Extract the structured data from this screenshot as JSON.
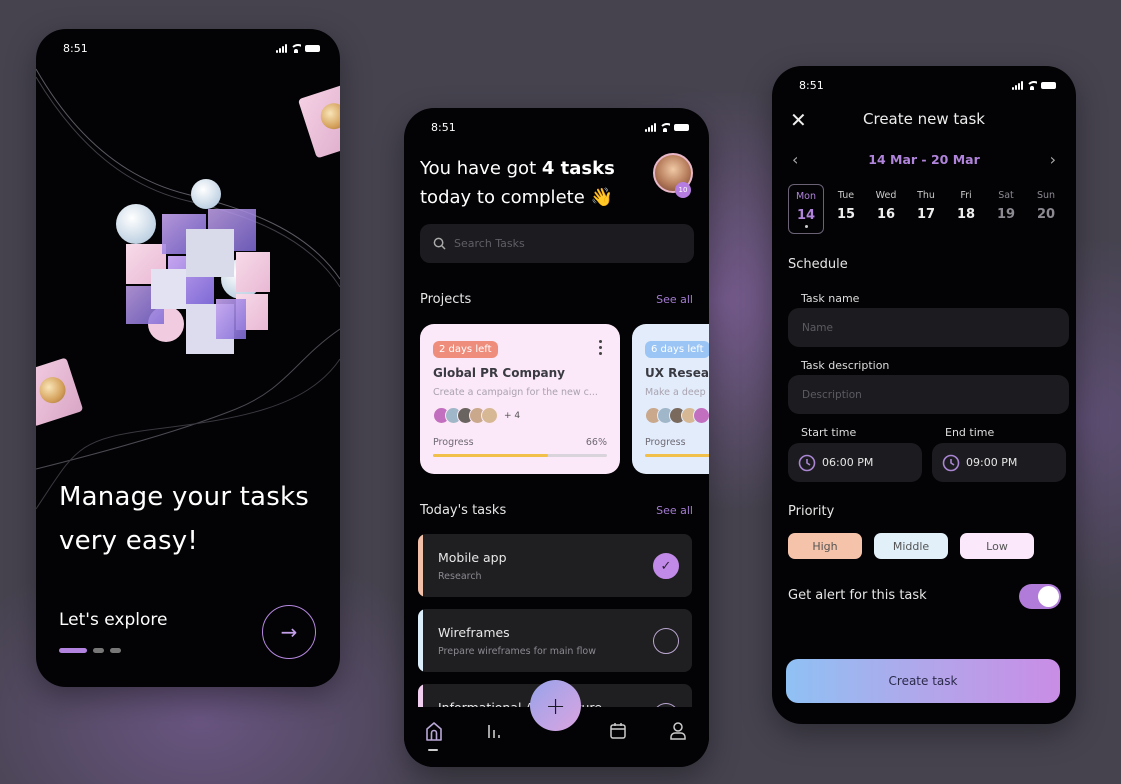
{
  "status": {
    "time": "8:51"
  },
  "onboarding": {
    "title": "Manage your tasks very easy!",
    "explore_label": "Let's explore",
    "page_count": 3,
    "active_page": 1,
    "accent": "#b383e0"
  },
  "home": {
    "greeting_prefix": "You have got",
    "greeting_count": "4 tasks",
    "greeting_suffix": "today to complete",
    "greeting_emoji": "👋",
    "avatar_badge": "10",
    "search_placeholder": "Search Tasks",
    "projects_title": "Projects",
    "see_all": "See all",
    "projects": [
      {
        "badge": "2 days left",
        "badge_color": "#ef8d7d",
        "bg": "#fbe8f8",
        "title": "Global PR Company",
        "description": "Create a campaign for the  new c...",
        "extra_members": "+ 4",
        "progress_label": "Progress",
        "progress_value": "66%",
        "progress": 0.66
      },
      {
        "badge": "6 days left",
        "badge_color": "#9bc5f5",
        "bg": "#e2ecfb",
        "title": "UX Research",
        "description": "Make a deep research",
        "extra_members": "",
        "progress_label": "Progress",
        "progress_value": "",
        "progress": 0.5
      }
    ],
    "tasks_title": "Today's tasks",
    "tasks_see_all": "See all",
    "tasks": [
      {
        "name": "Mobile app",
        "subtitle": "Research",
        "done": true,
        "stripe": "#f2bfa8"
      },
      {
        "name": "Wireframes",
        "subtitle": "Prepare wireframes for main flow",
        "done": false,
        "stripe": "#dceefa"
      },
      {
        "name": "Informational Architecture",
        "subtitle": "",
        "done": false,
        "stripe": "#f1cdf0"
      }
    ],
    "nav": {
      "home": "home-icon",
      "stats": "stats-icon",
      "add": "+",
      "calendar": "calendar-icon",
      "profile": "profile-icon",
      "active": "home"
    }
  },
  "create_task": {
    "title": "Create new task",
    "week_range": "14 Mar - 20 Mar",
    "days": [
      {
        "name": "Mon",
        "date": "14",
        "selected": true
      },
      {
        "name": "Tue",
        "date": "15"
      },
      {
        "name": "Wed",
        "date": "16"
      },
      {
        "name": "Thu",
        "date": "17"
      },
      {
        "name": "Fri",
        "date": "18"
      },
      {
        "name": "Sat",
        "date": "19",
        "weekend": true
      },
      {
        "name": "Sun",
        "date": "20",
        "weekend": true
      }
    ],
    "schedule_label": "Schedule",
    "task_name_label": "Task name",
    "task_name_placeholder": "Name",
    "task_desc_label": "Task description",
    "task_desc_placeholder": "Description",
    "start_label": "Start time",
    "start_value": "06:00 PM",
    "end_label": "End time",
    "end_value": "09:00 PM",
    "priority_label": "Priority",
    "priorities": [
      {
        "label": "High",
        "color": "#f5c3a9"
      },
      {
        "label": "Middle",
        "color": "#e1f0f9"
      },
      {
        "label": "Low",
        "color": "#fbe9fb"
      }
    ],
    "alert_label": "Get alert for this task",
    "alert_enabled": true,
    "create_label": "Create task"
  }
}
